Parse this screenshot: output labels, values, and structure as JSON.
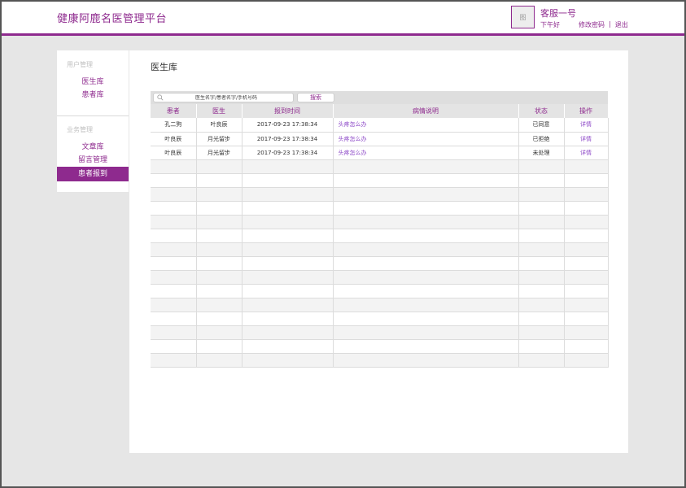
{
  "header": {
    "app_title": "健康阿鹿名医管理平台",
    "avatar_label": "图",
    "username": "客服一号",
    "greeting": "下午好",
    "change_password": "修改密码",
    "separator": "|",
    "logout": "退出"
  },
  "sidebar": {
    "groups": [
      {
        "title": "用户管理",
        "items": [
          {
            "label": "医生库"
          },
          {
            "label": "患者库"
          }
        ]
      },
      {
        "title": "业务管理",
        "items": [
          {
            "label": "文章库"
          },
          {
            "label": "留言管理"
          },
          {
            "label": "患者报到",
            "active": true
          }
        ]
      }
    ]
  },
  "main": {
    "page_title": "医生库",
    "search": {
      "placeholder": "医生名字/患者名字/手机号码",
      "value": "",
      "button_label": "搜索"
    },
    "table": {
      "columns": [
        "患者",
        "医生",
        "报到时间",
        "病情说明",
        "状态",
        "操作"
      ],
      "rows": [
        {
          "patient": "孔二狗",
          "doctor": "叶良辰",
          "time": "2017-09-23  17:38:34",
          "description": "头疼怎么办",
          "status": "已同意",
          "action": "详情"
        },
        {
          "patient": "叶良辰",
          "doctor": "月光留步",
          "time": "2017-09-23  17:38:34",
          "description": "头疼怎么办",
          "status": "已拒绝",
          "action": "详情"
        },
        {
          "patient": "叶良辰",
          "doctor": "月光留步",
          "time": "2017-09-23  17:38:34",
          "description": "头疼怎么办",
          "status": "未处理",
          "action": "详情"
        }
      ]
    }
  },
  "colors": {
    "brand": "#8e2a8e",
    "link": "#8e4ac8"
  }
}
